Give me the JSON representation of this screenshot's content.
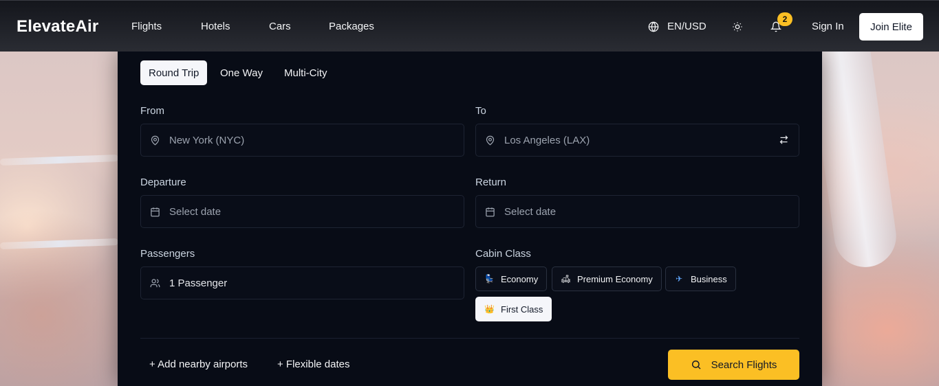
{
  "brand": {
    "name": "ElevateAir",
    "accent": "#fbbf24"
  },
  "nav": {
    "links": [
      "Flights",
      "Hotels",
      "Cars",
      "Packages"
    ],
    "language": "EN/USD",
    "notifications_count": "2",
    "sign_in": "Sign In",
    "join": "Join Elite"
  },
  "search": {
    "trip_types": [
      "Round Trip",
      "One Way",
      "Multi-City"
    ],
    "active_trip_type": "Round Trip",
    "from": {
      "label": "From",
      "placeholder": "New York (NYC)",
      "icon": "map-pin-icon"
    },
    "to": {
      "label": "To",
      "placeholder": "Los Angeles (LAX)",
      "icon": "map-pin-icon"
    },
    "departure": {
      "label": "Departure",
      "placeholder": "Select date",
      "icon": "calendar-icon"
    },
    "return": {
      "label": "Return",
      "placeholder": "Select date",
      "icon": "calendar-icon"
    },
    "passengers": {
      "label": "Passengers",
      "value": "1 Passenger",
      "icon": "users-icon"
    },
    "cabin": {
      "label": "Cabin Class",
      "options": [
        {
          "label": "Economy",
          "emoji": "💺"
        },
        {
          "label": "Premium Economy",
          "emoji": "🛋"
        },
        {
          "label": "Business",
          "emoji": "✈"
        },
        {
          "label": "First Class",
          "emoji": "👑"
        }
      ],
      "selected": "First Class"
    },
    "extras": [
      "+ Add nearby airports",
      "+ Flexible dates"
    ],
    "submit": "Search Flights"
  }
}
